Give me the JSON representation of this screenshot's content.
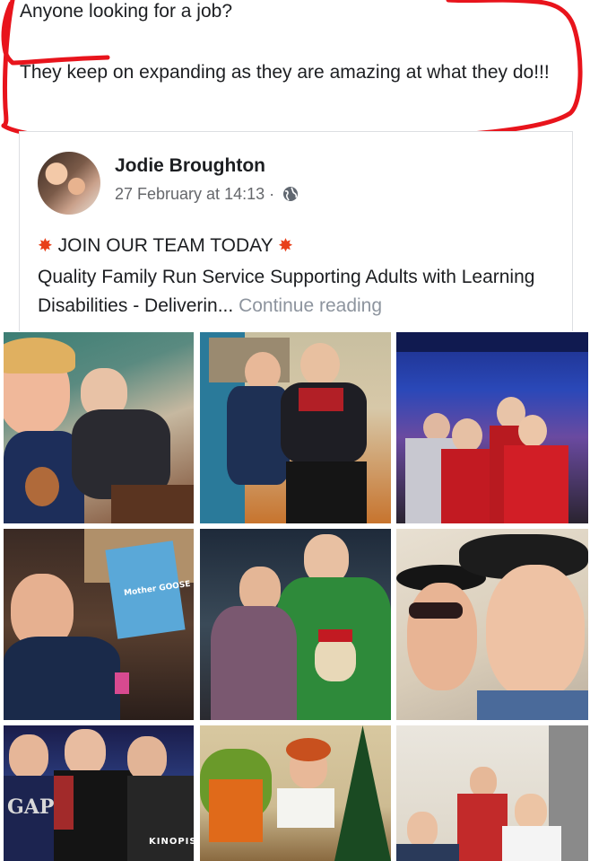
{
  "post": {
    "text_line1": "Anyone looking for a job?",
    "text_line2": "They keep on expanding as they are amazing at what they do!!!",
    "annotation_color": "#e8141c"
  },
  "shared_post": {
    "author": "Jodie Broughton",
    "timestamp": "27 February at 14:13",
    "separator": "·",
    "audience_icon": "globe-icon",
    "headline_icon": "sparkle-emoji",
    "headline": "JOIN OUR TEAM TODAY",
    "body": "Quality Family Run Service Supporting Adults with Learning Disabilities - Deliverin...",
    "more_label": "Continue reading"
  },
  "photos": [
    {
      "name": "photo-selfie-christmas-jumper"
    },
    {
      "name": "photo-two-men-wheelchair"
    },
    {
      "name": "photo-bowling-group"
    },
    {
      "name": "photo-man-with-dvd"
    },
    {
      "name": "photo-couple-elf-jumper"
    },
    {
      "name": "photo-hats-selfie"
    },
    {
      "name": "photo-three-men-kinopia"
    },
    {
      "name": "photo-woman-flowers-christmas-tree"
    },
    {
      "name": "photo-group-indoors"
    }
  ],
  "photo_text": {
    "poster": "Mother GOOSE",
    "shirt": "KINOPIS",
    "gap": "GAP"
  }
}
